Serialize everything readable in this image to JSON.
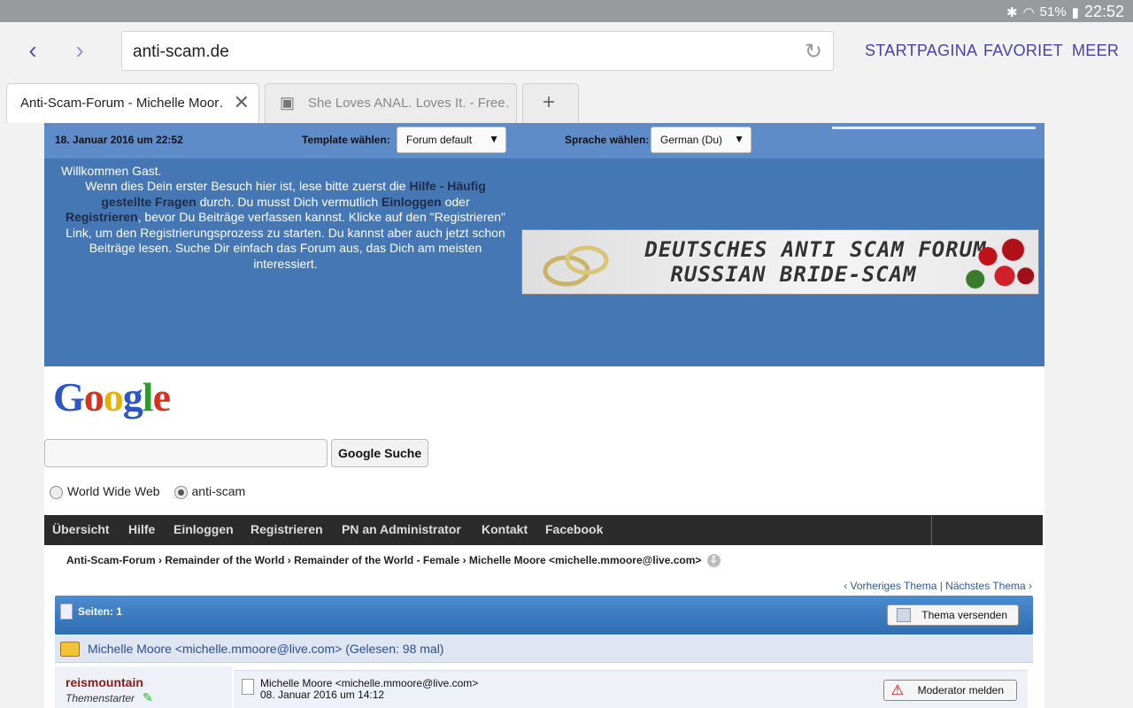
{
  "statusbar": {
    "battery": "51%",
    "time": "22:52"
  },
  "browser": {
    "url": "anti-scam.de",
    "links": [
      "STARTPAGINA",
      "FAVORIET",
      "MEER"
    ],
    "tabs": [
      {
        "title": "Anti-Scam-Forum - Michelle Moor…"
      },
      {
        "title": "She Loves ANAL. Loves It. - Free…"
      }
    ]
  },
  "forum": {
    "date": "18. Januar 2016 um 22:52",
    "template_label": "Template wählen:",
    "template_value": "Forum default",
    "language_label": "Sprache wählen:",
    "language_value": "German (Du)",
    "welcome": {
      "hello": "Willkommen Gast.",
      "p1": "Wenn dies Dein erster Besuch hier ist, lese bitte zuerst die ",
      "faq": "Hilfe - Häufig gestellte Fragen",
      "p2": " durch. Du musst Dich vermutlich ",
      "login": "Einloggen",
      "p3": " oder ",
      "register": "Registrieren",
      "p4": ", bevor Du Beiträge verfassen kannst. Klicke auf den \"Registrieren\" Link, um den Registrierungsprozess zu starten. Du kannst aber auch jetzt schon Beiträge lesen. Suche Dir einfach das Forum aus, das Dich am meisten interessiert."
    },
    "banner": {
      "line1": "DEUTSCHES ANTI SCAM FORUM",
      "line2": "RUSSIAN BRIDE-SCAM"
    },
    "google": {
      "logo": "Google",
      "button": "Google Suche",
      "opt1": "World Wide Web",
      "opt2": "anti-scam"
    },
    "nav": [
      "Übersicht",
      "Hilfe",
      "Einloggen",
      "Registrieren",
      "PN an Administrator",
      "Kontakt",
      "Facebook"
    ],
    "breadcrumb": "Anti-Scam-Forum › Remainder of the World › Remainder of the World - Female › Michelle Moore <michelle.mmoore@live.com>",
    "prev": "‹ Vorheriges Thema",
    "next": "Nächstes Thema ›",
    "pages": "Seiten: 1",
    "send_topic": "Thema versenden",
    "topic_title": "Michelle Moore <michelle.mmoore@live.com> (Gelesen: 98 mal)",
    "poster_name": "reismountain",
    "poster_role": "Themenstarter",
    "post_subject": "Michelle Moore <michelle.mmoore@live.com>",
    "post_date": "08. Januar 2016 um 14:12",
    "report": "Moderator melden"
  }
}
